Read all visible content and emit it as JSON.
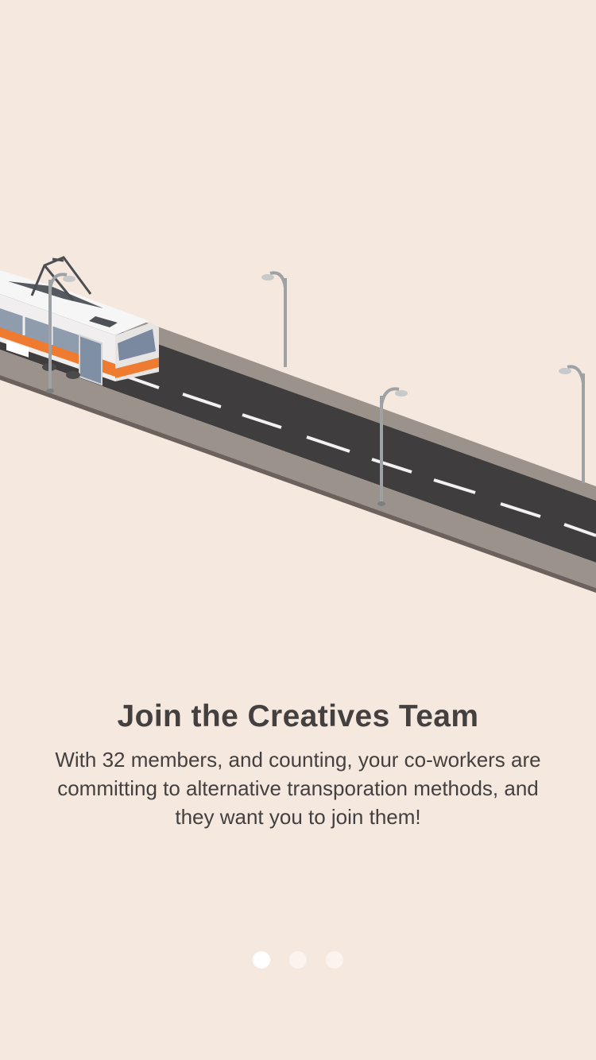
{
  "onboarding": {
    "title": "Join the Creatives Team",
    "description": "With 32 members, and counting, your co-workers are committing to alternative transporation methods, and they want you to join them!",
    "illustration_icon": "tram-on-road-icon",
    "pages": [
      {
        "active": true
      },
      {
        "active": false
      },
      {
        "active": false
      }
    ]
  },
  "colors": {
    "background": "#f5e8de",
    "text": "#444040",
    "road": "#3f3d3e",
    "sidewalk": "#9a918b",
    "tram_accent": "#ee7b2f"
  }
}
